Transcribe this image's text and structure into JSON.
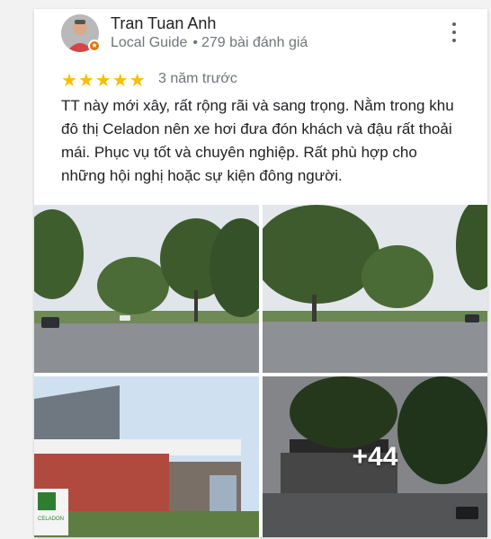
{
  "review": {
    "author_name": "Tran Tuan Anh",
    "author_level": "Local Guide",
    "review_count": "279 bài đánh giá",
    "rating": 5,
    "rating_stars": "★★★★★",
    "time_ago": "3 năm trước",
    "text": "TT này mới xây, rất rộng rãi và sang trọng. Nằm trong khu đô thị Celadon nên xe hơi đưa đón khách và đậu rất thoải mái. Phục vụ tốt và chuyên nghiệp. Rất phù hợp cho những hội nghị hoặc sự kiện đông người.",
    "more_photos_label": "+44",
    "logo_text": "CELADON",
    "badge_icon": "local-guide-star-icon",
    "menu_icon": "more-vert-icon"
  },
  "colors": {
    "star": "#fbbc04",
    "badge": "#e37400",
    "text_primary": "#202124",
    "text_secondary": "#70757a"
  }
}
